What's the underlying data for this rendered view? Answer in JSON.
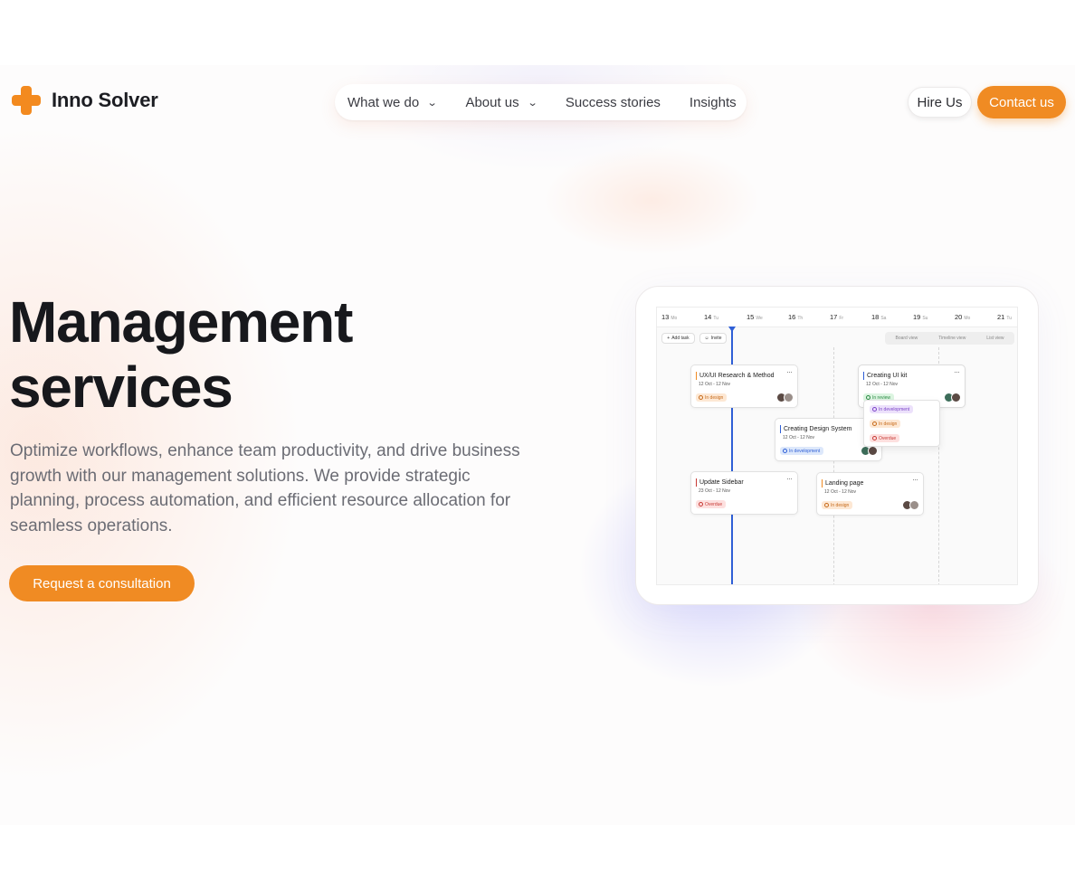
{
  "brand": {
    "name": "Inno Solver",
    "accent": "#f08b23"
  },
  "nav": {
    "items": [
      {
        "label": "What we do",
        "has_dropdown": true
      },
      {
        "label": "About us",
        "has_dropdown": true
      },
      {
        "label": "Success stories",
        "has_dropdown": false
      },
      {
        "label": "Insights",
        "has_dropdown": false
      }
    ],
    "chevron": "⌄"
  },
  "header": {
    "hire_label": "Hire Us",
    "contact_label": "Contact us"
  },
  "hero": {
    "title_line1": "Management",
    "title_line2": "services",
    "description": "Optimize workflows, enhance team productivity, and drive business growth with our management solutions. We provide strategic planning, process automation, and efficient resource allocation for seamless operations.",
    "cta_label": "Request a consultation"
  },
  "mockup": {
    "days": [
      {
        "num": "13",
        "dow": "Mo"
      },
      {
        "num": "14",
        "dow": "Tu"
      },
      {
        "num": "15",
        "dow": "We"
      },
      {
        "num": "16",
        "dow": "Th"
      },
      {
        "num": "17",
        "dow": "Fr"
      },
      {
        "num": "18",
        "dow": "Sa"
      },
      {
        "num": "19",
        "dow": "Su"
      },
      {
        "num": "20",
        "dow": "Mo"
      },
      {
        "num": "21",
        "dow": "Tu"
      }
    ],
    "toolbar": {
      "add_task": "Add task",
      "invite": "Invite",
      "board_view": "Board view",
      "timeline_view": "Timeline view",
      "list_view": "List view"
    },
    "cards": [
      {
        "title": "UX/UI Research & Method",
        "date": "12 Oct - 12 Nov",
        "status": "In design",
        "status_color": "#c66a1a"
      },
      {
        "title": "Creating UI kit",
        "date": "12 Oct - 12 Nov",
        "status": "In review",
        "status_color": "#2a8a43"
      },
      {
        "title": "Creating Design System",
        "date": "12 Oct - 12 Nov",
        "status": "In development",
        "status_color": "#2f5fd6"
      },
      {
        "title": "Update Sidebar",
        "date": "23 Oct - 12 Nov",
        "status": "Overdue",
        "status_color": "#c73a35"
      },
      {
        "title": "Landing page",
        "date": "12 Oct - 12 Nov",
        "status": "In design",
        "status_color": "#c66a1a"
      }
    ],
    "status_menu": [
      "In development",
      "In design",
      "Overdue"
    ],
    "more_glyph": "···"
  }
}
